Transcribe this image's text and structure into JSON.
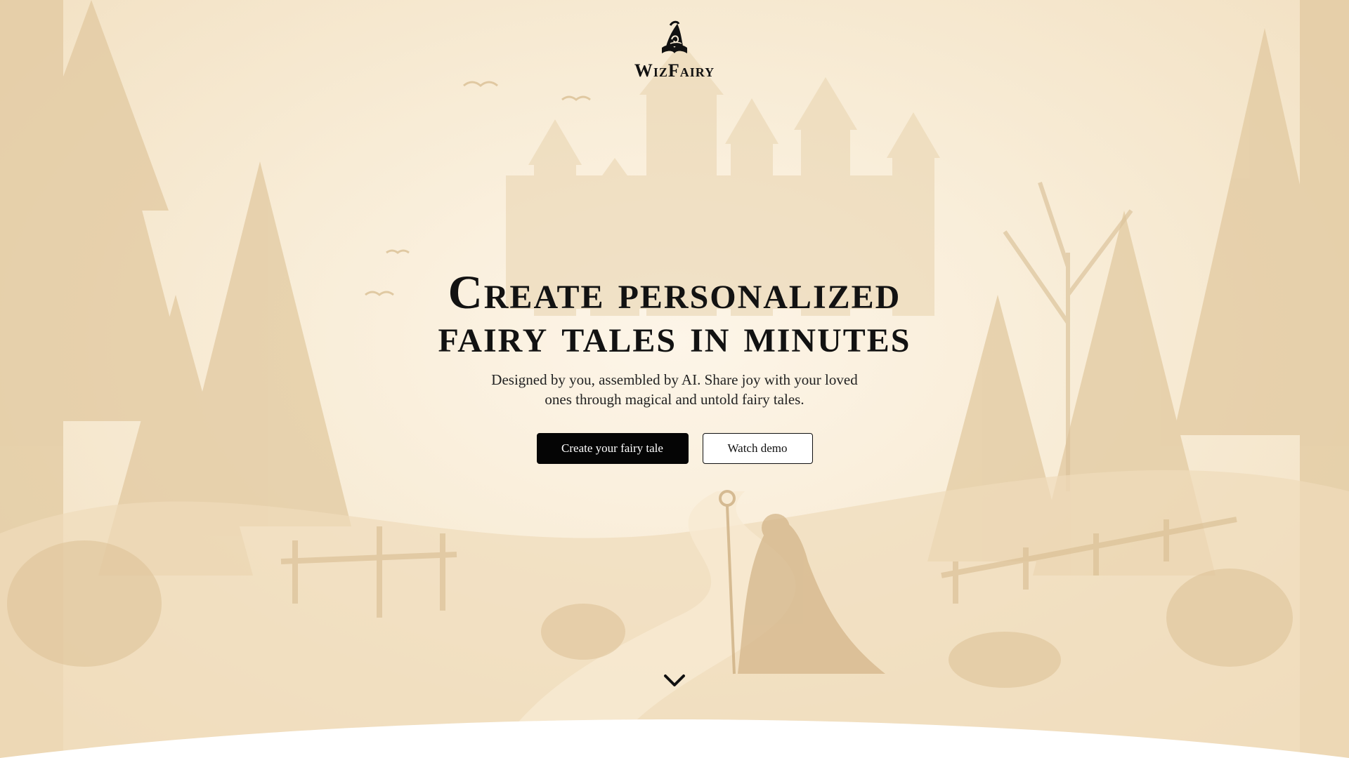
{
  "brand": {
    "name": "WizFairy",
    "logo_icon": "wizard-hat-book-icon"
  },
  "hero": {
    "headline_line1": "Create personalized",
    "headline_line2": "fairy tales in minutes",
    "subtitle_line1": "Designed by you, assembled by AI. Share joy with your loved",
    "subtitle_line2": "ones through magical and untold fairy tales."
  },
  "actions": {
    "primary_label": "Create your fairy tale",
    "secondary_label": "Watch demo"
  },
  "scroll": {
    "icon": "chevron-down-icon"
  },
  "colors": {
    "background": "#f7ebd6",
    "illustration": "#e6cfa8",
    "text": "#121212",
    "primary_button": "#050505",
    "secondary_button": "#ffffff"
  }
}
